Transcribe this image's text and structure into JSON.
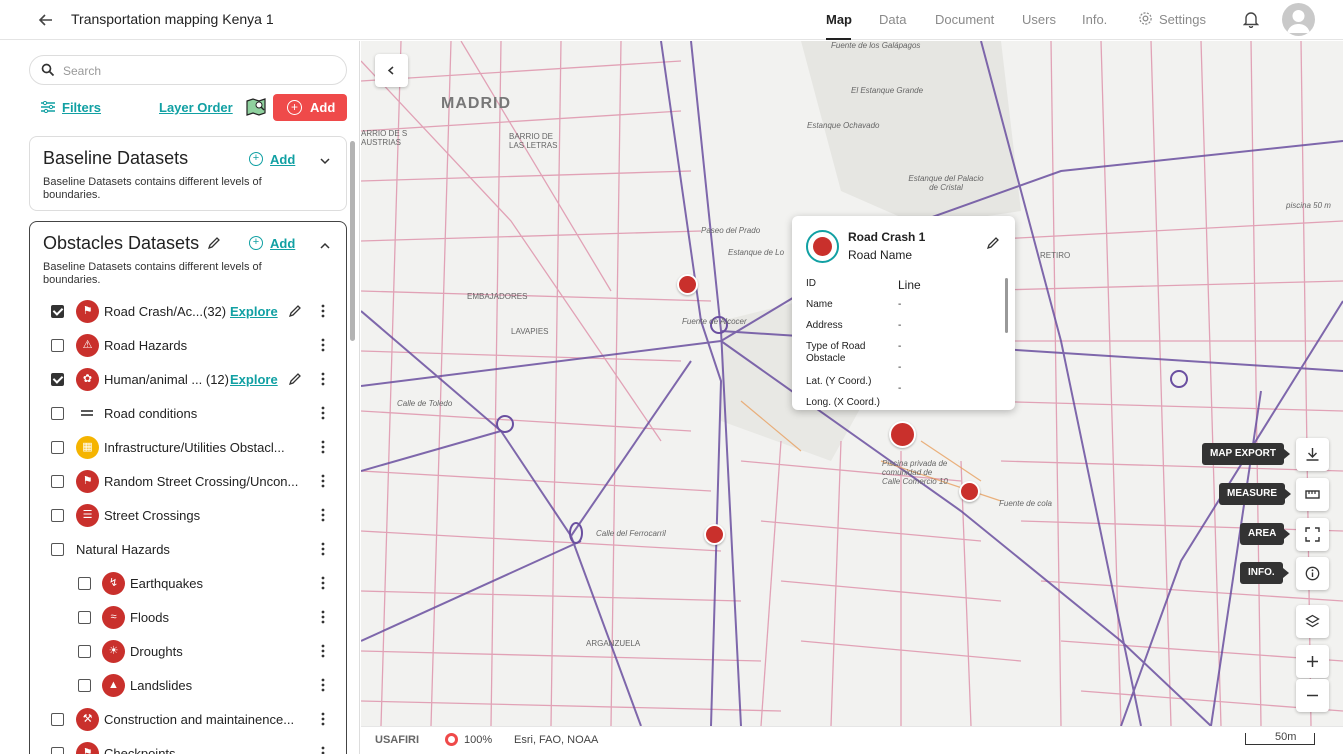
{
  "header": {
    "title": "Transportation mapping Kenya 1",
    "nav": [
      "Map",
      "Data",
      "Document",
      "Users",
      "Info.",
      "Settings"
    ]
  },
  "panel": {
    "search_placeholder": "Search",
    "filters": "Filters",
    "layer_order": "Layer Order",
    "add": "Add",
    "baseline": {
      "title": "Baseline Datasets",
      "add": "Add",
      "desc": "Baseline Datasets contains different levels of boundaries."
    },
    "obstacles": {
      "title": "Obstacles Datasets",
      "add": "Add",
      "desc": "Baseline Datasets contains different levels of boundaries.",
      "explore": "Explore",
      "layers": [
        {
          "name": "Road Crash/Ac...(32)",
          "checked": true,
          "icon": "car-crash-icon",
          "color": "#c9302c"
        },
        {
          "name": "Road Hazards",
          "checked": false,
          "icon": "warning-triangle-icon",
          "color": "#c9302c"
        },
        {
          "name": "Human/animal ... (12)",
          "checked": true,
          "icon": "paw-icon",
          "color": "#c9302c"
        },
        {
          "name": "Road conditions",
          "checked": false,
          "icon": "equals-line-icon",
          "color": "#222222"
        },
        {
          "name": "Infrastructure/Utilities Obstacl...",
          "checked": false,
          "icon": "building-icon",
          "color": "#f5b400"
        },
        {
          "name": "Random Street Crossing/Uncon...",
          "checked": false,
          "icon": "car-crash-icon",
          "color": "#c9302c"
        },
        {
          "name": "Street Crossings",
          "checked": false,
          "icon": "crossing-icon",
          "color": "#c9302c"
        },
        {
          "name": "Natural Hazards",
          "checked": false,
          "icon": "",
          "color": ""
        },
        {
          "name": "Earthquakes",
          "checked": false,
          "icon": "earthquake-icon",
          "color": "#c9302c"
        },
        {
          "name": "Floods",
          "checked": false,
          "icon": "flood-icon",
          "color": "#c9302c"
        },
        {
          "name": "Droughts",
          "checked": false,
          "icon": "drought-icon",
          "color": "#c9302c"
        },
        {
          "name": "Landslides",
          "checked": false,
          "icon": "landslide-icon",
          "color": "#c9302c"
        },
        {
          "name": "Construction and maintainence...",
          "checked": false,
          "icon": "construction-icon",
          "color": "#c9302c"
        },
        {
          "name": "Checkpoints",
          "checked": false,
          "icon": "checkpoint-icon",
          "color": "#c9302c"
        }
      ]
    }
  },
  "map": {
    "city_label": "MADRID",
    "place_labels": [
      "Fuente de los Galápagos",
      "El Estanque Grande",
      "Estanque Ochavado",
      "Estanque del Palacio de Cristal",
      "piscina 50 m",
      "ARRIO DE S AUSTRIAS",
      "BARRIO DE LAS LETRAS",
      "EMBAJADORES",
      "LAVAPIES",
      "RETIRO",
      "Estanque de Lo",
      "Fuente de Alcocer",
      "Piscina privada de comunidad de Calle Comercio 10",
      "Fuente de cola",
      "Calle del Ferrocarril",
      "ARGANZUELA",
      "Paseo del Prado",
      "Calle de Toledo"
    ],
    "popup": {
      "title": "Road Crash 1",
      "subtitle": "Road Name",
      "rows": [
        {
          "label": "ID",
          "value": "Line"
        },
        {
          "label": "Name",
          "value": "-"
        },
        {
          "label": "Address",
          "value": "-"
        },
        {
          "label": "Type of Road Obstacle",
          "value": "-"
        },
        {
          "label": "Lat. (Y Coord.)",
          "value": "-"
        },
        {
          "label": "Long. (X Coord.)",
          "value": "-"
        }
      ]
    },
    "tools": {
      "map_export": "MAP EXPORT",
      "measure": "MEASURE",
      "area": "AREA",
      "info": "INFO."
    },
    "bottom": {
      "brand": "USAFIRI",
      "opacity": "100%",
      "attribution": "Esri, FAO, NOAA",
      "scale": "50m"
    }
  },
  "colors": {
    "accent": "#11a0a3",
    "brand_red": "#ef4a4a",
    "pin_red": "#c9302c"
  }
}
